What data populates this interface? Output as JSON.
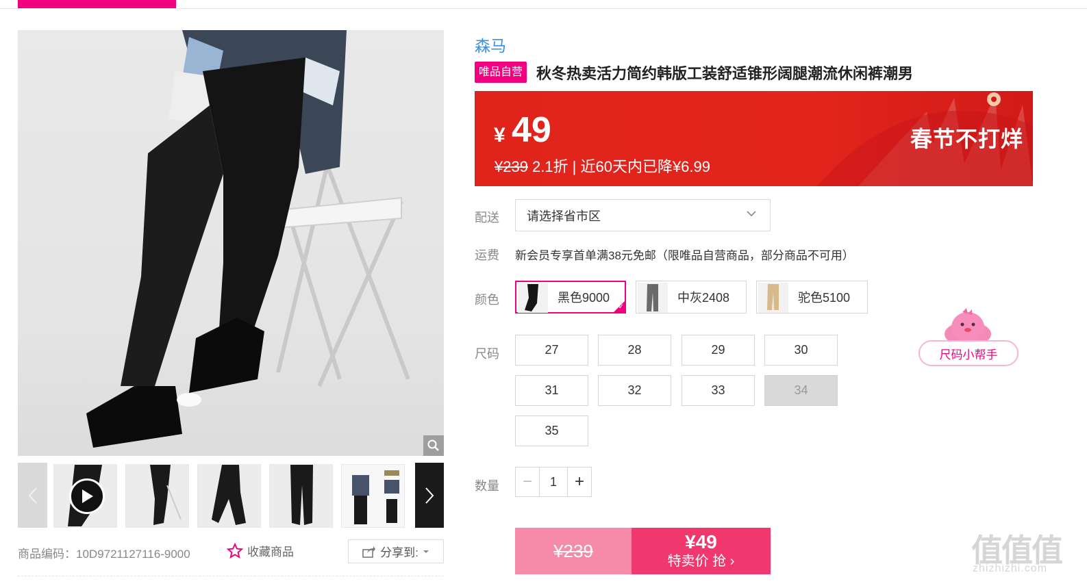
{
  "gallery": {
    "thumbnails": [
      "video-thumb",
      "side-pose",
      "walking-pose",
      "front-pants",
      "outfit-combo"
    ]
  },
  "meta": {
    "product_code": "商品编码：10D9721127116-9000",
    "favorite_label": "收藏商品",
    "share_label": "分享到:"
  },
  "product": {
    "brand": "森马",
    "self_tag": "唯品自营",
    "title": "秋冬热卖活力简约韩版工装舒适锥形阔腿潮流休闲裤潮男"
  },
  "price": {
    "currency": "¥",
    "current": "49",
    "original": "¥239",
    "discount_text": "2.1折 | 近60天内已降¥6.99",
    "slogan": "春节不打烊"
  },
  "delivery": {
    "label": "配送",
    "placeholder": "请选择省市区"
  },
  "shipping": {
    "label": "运费",
    "text": "新会员专享首单满38元免邮（限唯品自营商品，部分商品不可用）"
  },
  "colors": {
    "label": "颜色",
    "options": [
      {
        "name": "黑色9000",
        "selected": true
      },
      {
        "name": "中灰2408",
        "selected": false
      },
      {
        "name": "驼色5100",
        "selected": false
      }
    ]
  },
  "sizes": {
    "label": "尺码",
    "options": [
      {
        "value": "27",
        "available": true
      },
      {
        "value": "28",
        "available": true
      },
      {
        "value": "29",
        "available": true
      },
      {
        "value": "30",
        "available": true
      },
      {
        "value": "31",
        "available": true
      },
      {
        "value": "32",
        "available": true
      },
      {
        "value": "33",
        "available": true
      },
      {
        "value": "34",
        "available": false
      },
      {
        "value": "35",
        "available": true
      }
    ],
    "helper_label": "尺码小帮手"
  },
  "quantity": {
    "label": "数量",
    "value": "1",
    "minus": "−",
    "plus": "+"
  },
  "buy": {
    "original_price": "¥239",
    "sale_price": "¥49",
    "action_label": "特卖价 抢 ›"
  },
  "watermark": {
    "logo": "值值值",
    "domain": "zhizhizhi.com"
  },
  "colors_theme": {
    "accent": "#f10180",
    "price_red": "#e0241c",
    "buy_pink": "#f0386e",
    "link_blue": "#3a8ee6"
  }
}
